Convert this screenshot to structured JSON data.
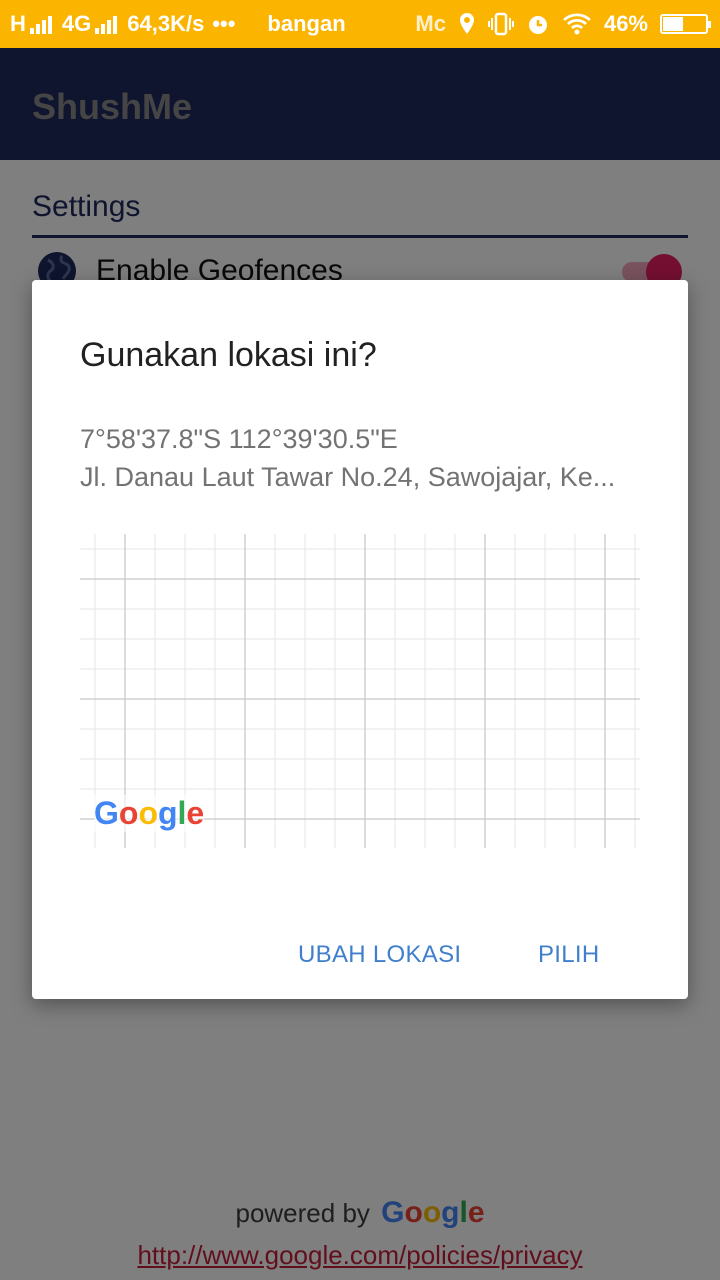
{
  "status_bar": {
    "network_left": "H",
    "network_4g": "4G",
    "speed": "64,3K/s",
    "dots": "•••",
    "carrier": "bangan",
    "carrier2": "Mc",
    "battery": "46%"
  },
  "app_bar": {
    "title": "ShushMe"
  },
  "settings": {
    "header": "Settings",
    "geofence_label": "Enable Geofences",
    "geofence_enabled": true
  },
  "dialog": {
    "title": "Gunakan lokasi ini?",
    "coordinates": "7°58'37.8\"S 112°39'30.5\"E",
    "address": "Jl. Danau Laut Tawar No.24, Sawojajar, Ke...",
    "map_attribution": [
      "G",
      "o",
      "o",
      "g",
      "l",
      "e"
    ],
    "change_button": "UBAH LOKASI",
    "select_button": "PILIH"
  },
  "footer": {
    "powered_by": "powered by",
    "google_letters": [
      "G",
      "o",
      "o",
      "g",
      "l",
      "e"
    ],
    "privacy_link": "http://www.google.com/policies/privacy"
  },
  "colors": {
    "status_bar": "#fbb400",
    "app_bar": "#1f295e",
    "accent": "#e91e63",
    "button_text": "#3f7fcc",
    "google_blue": "#4285f4",
    "google_red": "#ea4335",
    "google_yellow": "#fbbc05",
    "google_green": "#34a853"
  }
}
